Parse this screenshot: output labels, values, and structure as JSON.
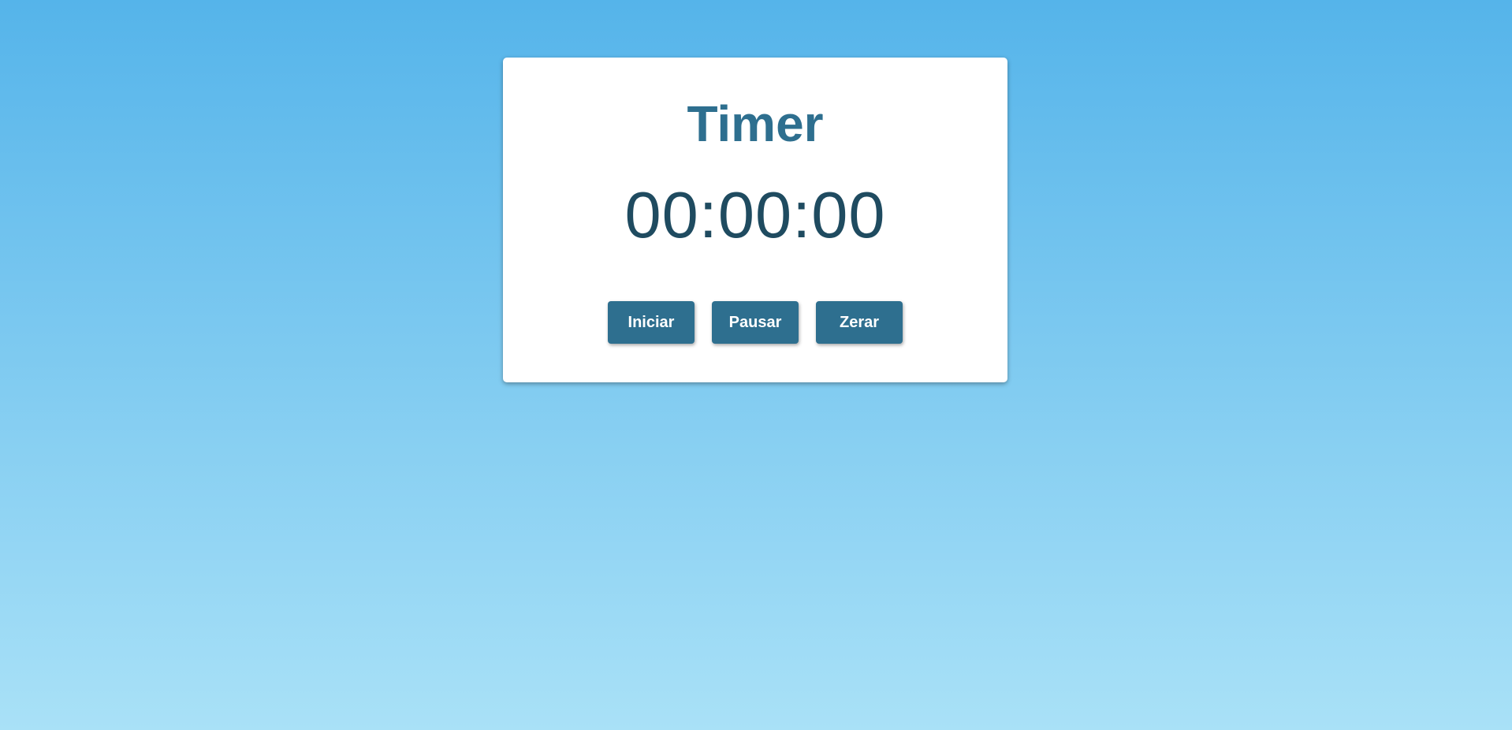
{
  "app": {
    "title": "Timer",
    "time_display": "00:00:00"
  },
  "controls": {
    "start_label": "Iniciar",
    "pause_label": "Pausar",
    "reset_label": "Zerar"
  },
  "colors": {
    "background_top": "#55b4ea",
    "background_bottom": "#a9e1f7",
    "card": "#ffffff",
    "title": "#2e6f8f",
    "clock": "#1f4b60",
    "button": "#2e6f8f",
    "button_text": "#ffffff"
  }
}
